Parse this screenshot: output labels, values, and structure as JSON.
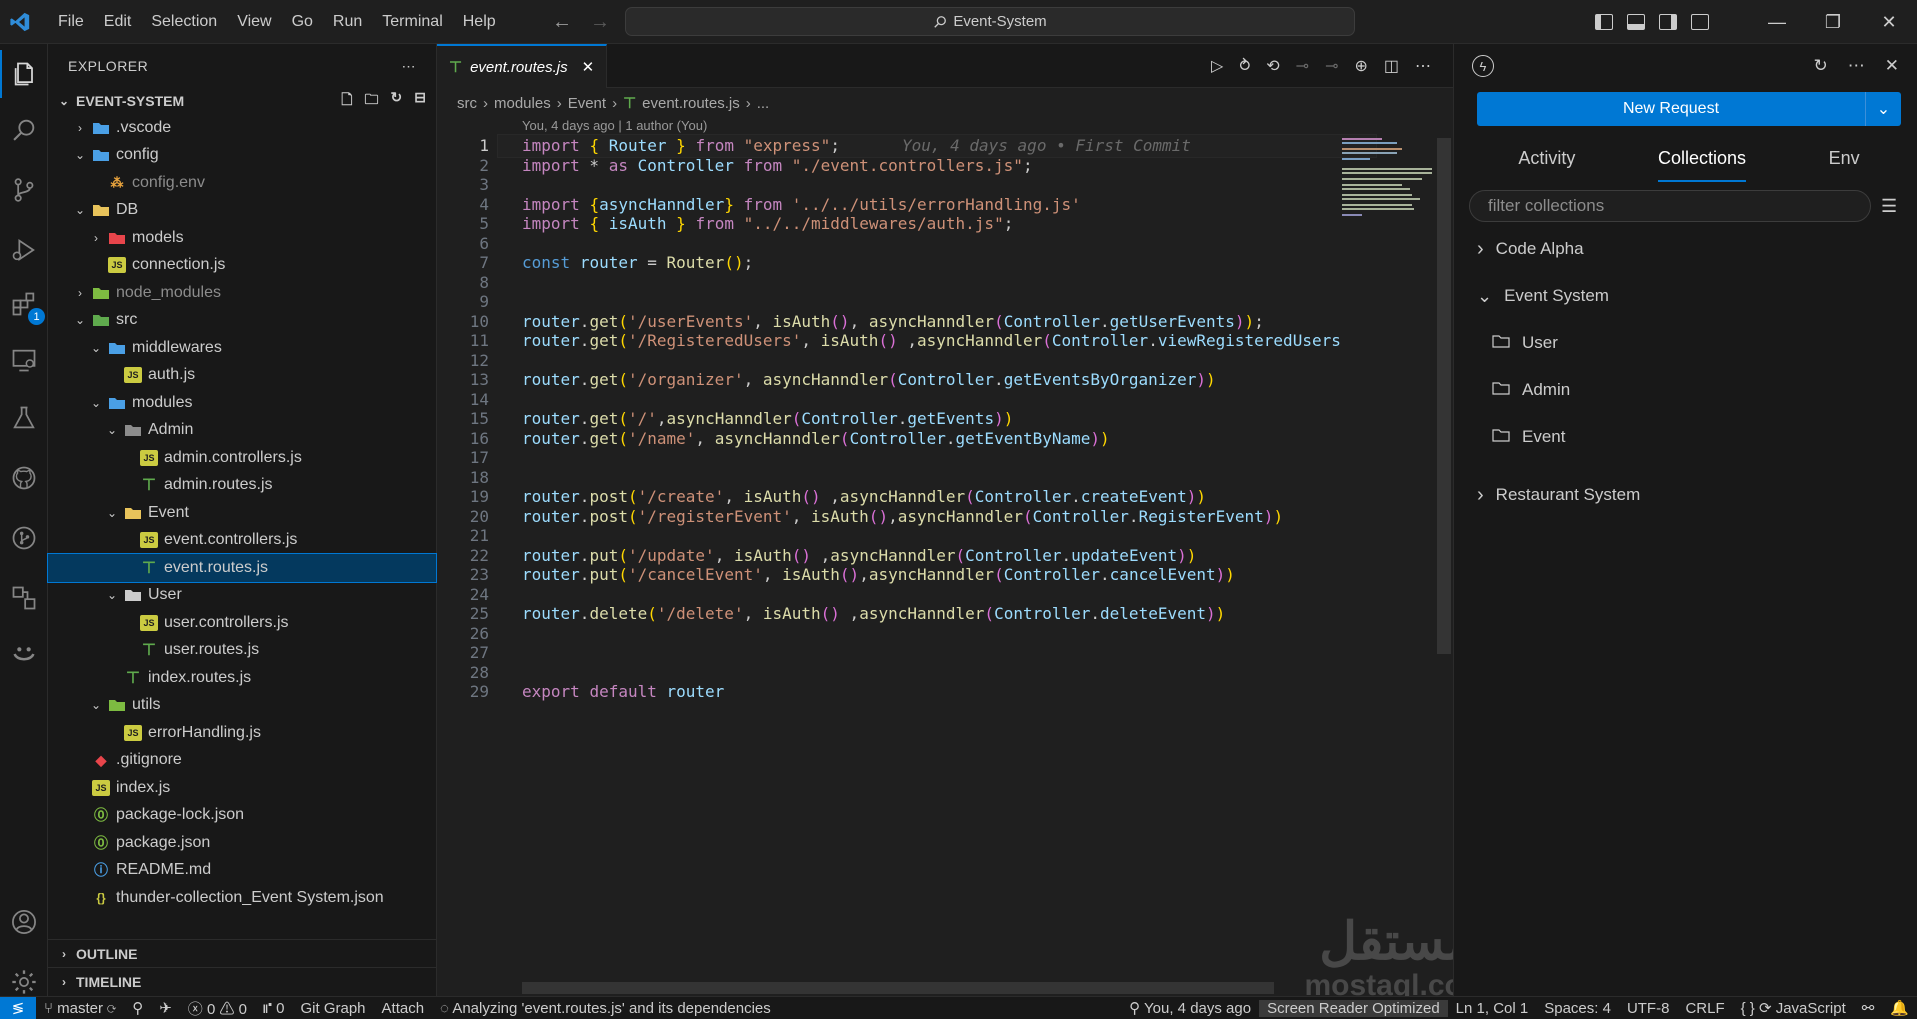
{
  "menu": [
    "File",
    "Edit",
    "Selection",
    "View",
    "Go",
    "Run",
    "Terminal",
    "Help"
  ],
  "search": {
    "label": "Event-System"
  },
  "explorer": {
    "title": "EXPLORER",
    "root": "EVENT-SYSTEM",
    "tree": [
      {
        "label": ".vscode",
        "indent": 1,
        "chev": ">",
        "icon": "folder-vscode",
        "color": "#4a9fe5"
      },
      {
        "label": "config",
        "indent": 1,
        "chev": "v",
        "icon": "folder-config",
        "color": "#4a9fe5"
      },
      {
        "label": "config.env",
        "indent": 2,
        "chev": "",
        "icon": "env-file",
        "color": "#e8a33d",
        "dim": true
      },
      {
        "label": "DB",
        "indent": 1,
        "chev": "v",
        "icon": "folder",
        "color": "#e8c35b"
      },
      {
        "label": "models",
        "indent": 2,
        "chev": ">",
        "icon": "folder-models",
        "color": "#e8454b"
      },
      {
        "label": "connection.js",
        "indent": 2,
        "chev": "",
        "icon": "js-file"
      },
      {
        "label": "node_modules",
        "indent": 1,
        "chev": ">",
        "icon": "folder-node",
        "color": "#7dbb41",
        "dim": true
      },
      {
        "label": "src",
        "indent": 1,
        "chev": "v",
        "icon": "folder-src",
        "color": "#5faa4d"
      },
      {
        "label": "middlewares",
        "indent": 2,
        "chev": "v",
        "icon": "folder-middleware",
        "color": "#4a9fe5"
      },
      {
        "label": "auth.js",
        "indent": 3,
        "chev": "",
        "icon": "js-file"
      },
      {
        "label": "modules",
        "indent": 2,
        "chev": "v",
        "icon": "folder-modules",
        "color": "#4a9fe5"
      },
      {
        "label": "Admin",
        "indent": 3,
        "chev": "v",
        "icon": "folder-admin",
        "color": "#8c8c8c"
      },
      {
        "label": "admin.controllers.js",
        "indent": 4,
        "chev": "",
        "icon": "js-file"
      },
      {
        "label": "admin.routes.js",
        "indent": 4,
        "chev": "",
        "icon": "routes-file"
      },
      {
        "label": "Event",
        "indent": 3,
        "chev": "v",
        "icon": "folder",
        "color": "#e8c35b"
      },
      {
        "label": "event.controllers.js",
        "indent": 4,
        "chev": "",
        "icon": "js-file"
      },
      {
        "label": "event.routes.js",
        "indent": 4,
        "chev": "",
        "icon": "routes-file",
        "selected": true
      },
      {
        "label": "User",
        "indent": 3,
        "chev": "v",
        "icon": "folder-user",
        "color": "#cccccc"
      },
      {
        "label": "user.controllers.js",
        "indent": 4,
        "chev": "",
        "icon": "js-file"
      },
      {
        "label": "user.routes.js",
        "indent": 4,
        "chev": "",
        "icon": "routes-file"
      },
      {
        "label": "index.routes.js",
        "indent": 3,
        "chev": "",
        "icon": "routes-file"
      },
      {
        "label": "utils",
        "indent": 2,
        "chev": "v",
        "icon": "folder-utils",
        "color": "#7dbb41"
      },
      {
        "label": "errorHandling.js",
        "indent": 3,
        "chev": "",
        "icon": "js-file"
      },
      {
        "label": ".gitignore",
        "indent": 1,
        "chev": "",
        "icon": "git-file",
        "color": "#e8454b"
      },
      {
        "label": "index.js",
        "indent": 1,
        "chev": "",
        "icon": "js-file"
      },
      {
        "label": "package-lock.json",
        "indent": 1,
        "chev": "",
        "icon": "npm-file",
        "color": "#7dbb41"
      },
      {
        "label": "package.json",
        "indent": 1,
        "chev": "",
        "icon": "npm-file",
        "color": "#7dbb41"
      },
      {
        "label": "README.md",
        "indent": 1,
        "chev": "",
        "icon": "info-file",
        "color": "#4a9fe5"
      },
      {
        "label": "thunder-collection_Event System.json",
        "indent": 1,
        "chev": "",
        "icon": "json-file",
        "color": "#cbcb41"
      }
    ],
    "outline": "OUTLINE",
    "timeline": "TIMELINE"
  },
  "editor": {
    "tab": "event.routes.js",
    "breadcrumb": [
      "src",
      "modules",
      "Event",
      "event.routes.js",
      "..."
    ],
    "blame": "You, 4 days ago | 1 author (You)",
    "ghost": "You, 4 days ago • First Commit",
    "lines": [
      "import { Router } from \"express\";",
      "import * as Controller from \"./event.controllers.js\";",
      "",
      "import {asyncHanndler} from '../../utils/errorHandling.js'",
      "import { isAuth } from \"../../middlewares/auth.js\";",
      "",
      "const router = Router();",
      "",
      "",
      "router.get('/userEvents', isAuth(), asyncHanndler(Controller.getUserEvents));",
      "router.get('/RegisteredUsers', isAuth() ,asyncHanndler(Controller.viewRegisteredUsers",
      "",
      "router.get('/organizer', asyncHanndler(Controller.getEventsByOrganizer))",
      "",
      "router.get('/',asyncHanndler(Controller.getEvents))",
      "router.get('/name', asyncHanndler(Controller.getEventByName))",
      "",
      "",
      "router.post('/create', isAuth() ,asyncHanndler(Controller.createEvent))",
      "router.post('/registerEvent', isAuth(),asyncHanndler(Controller.RegisterEvent))",
      "",
      "router.put('/update', isAuth() ,asyncHanndler(Controller.updateEvent))",
      "router.put('/cancelEvent', isAuth(),asyncHanndler(Controller.cancelEvent))",
      "",
      "router.delete('/delete', isAuth() ,asyncHanndler(Controller.deleteEvent))",
      "",
      "",
      "",
      "export default router"
    ]
  },
  "thunder": {
    "new_request": "New Request",
    "tabs": [
      "Activity",
      "Collections",
      "Env"
    ],
    "active_tab": "Collections",
    "filter_placeholder": "filter collections",
    "collections": [
      {
        "label": "Code Alpha",
        "type": "collapsed"
      },
      {
        "label": "Event System",
        "type": "expanded"
      },
      {
        "label": "User",
        "type": "folder"
      },
      {
        "label": "Admin",
        "type": "folder"
      },
      {
        "label": "Event",
        "type": "folder"
      },
      {
        "label": "Restaurant System",
        "type": "collapsed"
      }
    ]
  },
  "status": {
    "branch": "master",
    "errors": "0",
    "warnings": "0",
    "ports": "0",
    "git_graph": "Git Graph",
    "attach": "Attach",
    "analyzing": "Analyzing 'event.routes.js' and its dependencies",
    "blame": "You, 4 days ago",
    "screen_reader": "Screen Reader Optimized",
    "position": "Ln 1, Col 1",
    "spaces": "Spaces: 4",
    "encoding": "UTF-8",
    "eol": "CRLF",
    "language": "JavaScript"
  },
  "watermark": {
    "arabic": "مستقل",
    "latin": "mostaql.com"
  },
  "colors": {
    "accent": "#0078d4",
    "selection": "#04395e"
  }
}
